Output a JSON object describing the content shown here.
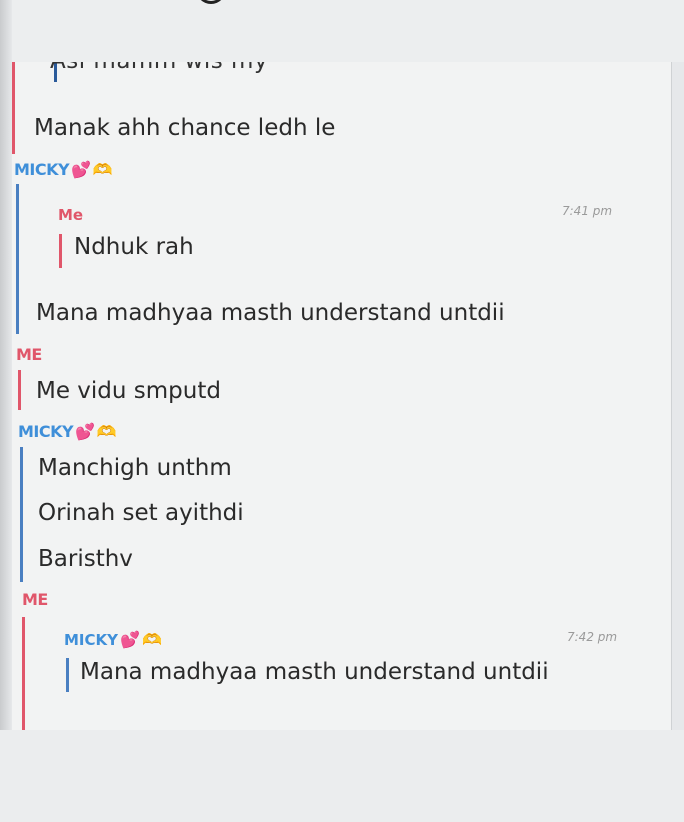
{
  "chat": {
    "partial_top_message": "Asi mamm wis my",
    "blocks": [
      {
        "sender": "",
        "messages": [
          "Manak ahh chance ledh le"
        ]
      },
      {
        "sender": "MICKY",
        "reply": {
          "quoted_sender": "Me",
          "quoted_text": "Ndhuk rah",
          "time": "7:41 pm"
        },
        "messages": [
          "Mana madhyaa masth understand untdii"
        ]
      },
      {
        "sender": "ME",
        "messages": [
          "Me vidu smputd"
        ]
      },
      {
        "sender": "MICKY",
        "messages": [
          "Manchigh unthm",
          "Orinah set ayithdi",
          "Baristhv"
        ]
      },
      {
        "sender": "ME",
        "reply": {
          "quoted_sender": "MICKY",
          "quoted_text": "Mana madhyaa masth understand untdii",
          "time": "7:42 pm"
        }
      }
    ]
  },
  "emoji": {
    "heart": "💕",
    "hands": "🫶"
  },
  "colors": {
    "micky": "#3f8fd9",
    "me": "#e0566a"
  }
}
